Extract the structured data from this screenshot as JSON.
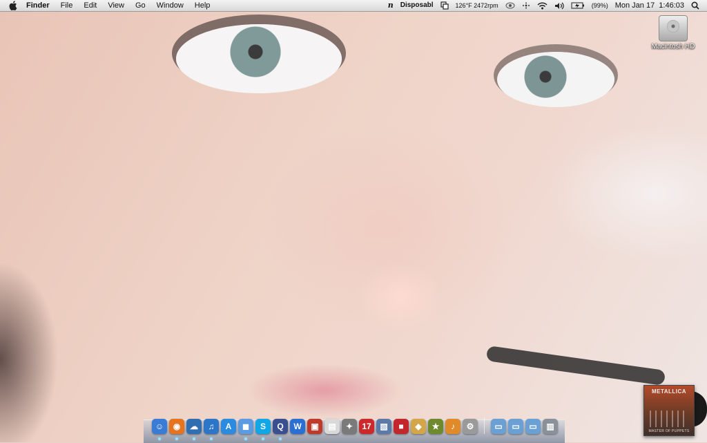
{
  "menubar": {
    "app_name": "Finder",
    "menus": [
      "File",
      "Edit",
      "View",
      "Go",
      "Window",
      "Help"
    ],
    "status": {
      "nocturne_glyph": "n",
      "disposable": "Disposabl",
      "temp_fan": "126°F 2472rpm",
      "battery": "(99%)",
      "clock": "Mon Jan 17  1:46:03"
    }
  },
  "desktop": {
    "hd_label": "Macintosh HD"
  },
  "album": {
    "band": "METALLICA",
    "caption": "MASTER OF PUPPETS"
  },
  "dock": {
    "apps": [
      {
        "name": "finder-icon",
        "glyph": "☺",
        "color": "#3a7bd5",
        "running": true
      },
      {
        "name": "firefox-icon",
        "glyph": "◉",
        "color": "#e8731f",
        "running": true
      },
      {
        "name": "network-icon",
        "glyph": "☁",
        "color": "#2f6fb1",
        "running": true
      },
      {
        "name": "itunes-icon",
        "glyph": "♫",
        "color": "#2b76c9",
        "running": true
      },
      {
        "name": "app-store-icon",
        "glyph": "A",
        "color": "#2a8be0",
        "running": false
      },
      {
        "name": "messages-icon",
        "glyph": "◼",
        "color": "#5b9be2",
        "running": true
      },
      {
        "name": "skype-icon",
        "glyph": "S",
        "color": "#11a6e5",
        "running": true
      },
      {
        "name": "quicksilver-icon",
        "glyph": "Q",
        "color": "#3a4f8f",
        "running": true
      },
      {
        "name": "word-icon",
        "glyph": "W",
        "color": "#2a6fd1",
        "running": false
      },
      {
        "name": "terminal-icon",
        "glyph": "▣",
        "color": "#c0392b",
        "running": false
      },
      {
        "name": "preview-icon",
        "glyph": "▤",
        "color": "#d9d9d9",
        "running": false
      },
      {
        "name": "imovie-icon",
        "glyph": "✦",
        "color": "#7a7a7a",
        "running": false
      },
      {
        "name": "ical-icon",
        "glyph": "17",
        "color": "#cc2a2a",
        "running": false
      },
      {
        "name": "iphoto-icon",
        "glyph": "▧",
        "color": "#5b7aa8",
        "running": false
      },
      {
        "name": "photo-booth-icon",
        "glyph": "■",
        "color": "#c1272d",
        "running": false
      },
      {
        "name": "aperture-icon",
        "glyph": "◆",
        "color": "#d4a64a",
        "running": false
      },
      {
        "name": "imovie-star-icon",
        "glyph": "★",
        "color": "#6e8a2d",
        "running": false
      },
      {
        "name": "garageband-icon",
        "glyph": "♪",
        "color": "#e08a2a",
        "running": false
      },
      {
        "name": "system-preferences-icon",
        "glyph": "⚙",
        "color": "#9a9a9a",
        "running": false
      }
    ],
    "stacks": [
      {
        "name": "documents-stack-icon",
        "glyph": "▭",
        "color": "#6aa0d4"
      },
      {
        "name": "downloads-stack-icon",
        "glyph": "▭",
        "color": "#6aa0d4"
      },
      {
        "name": "applications-stack-icon",
        "glyph": "▭",
        "color": "#6aa0d4"
      },
      {
        "name": "trash-icon",
        "glyph": "▥",
        "color": "#8a9199"
      }
    ]
  }
}
